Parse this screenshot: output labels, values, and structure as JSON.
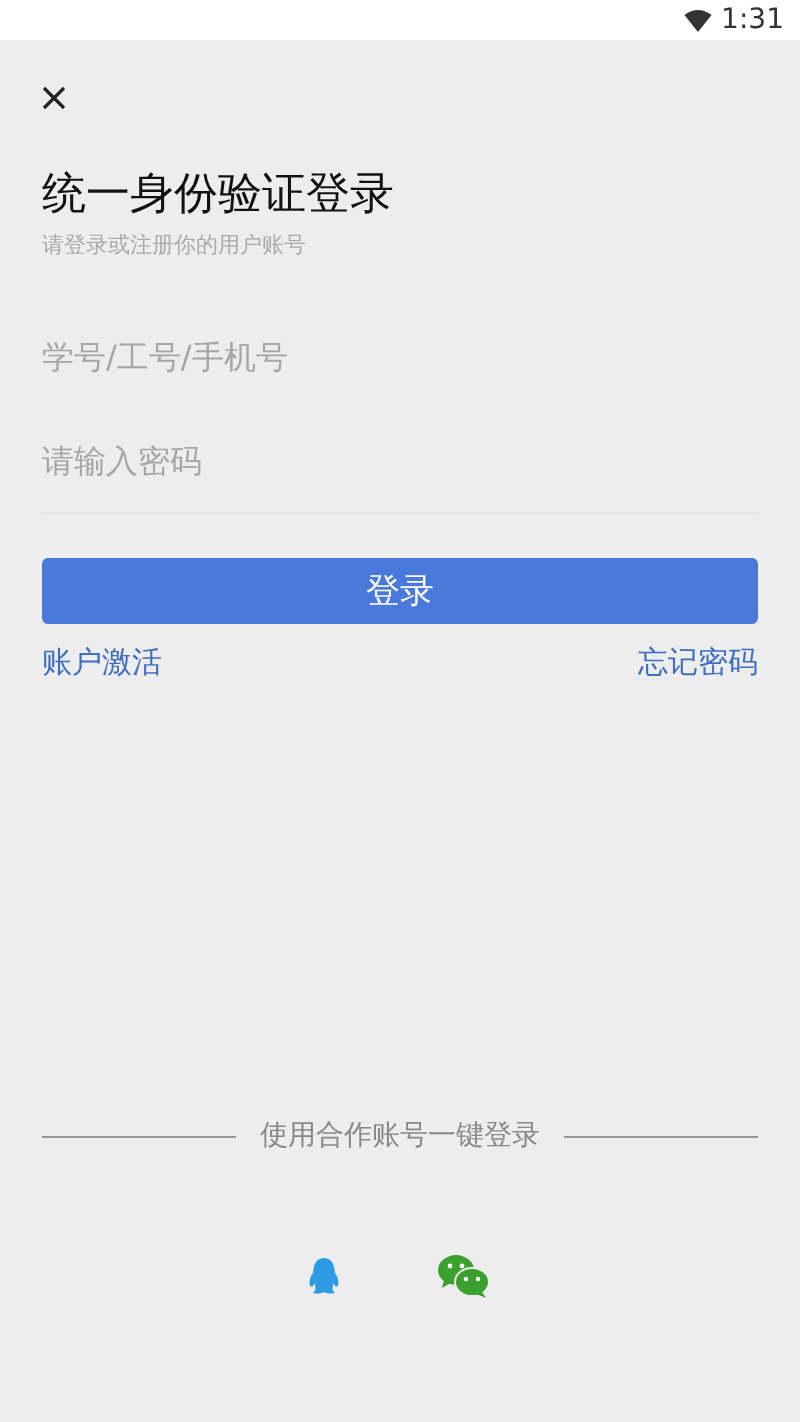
{
  "status_bar": {
    "time": "1:31"
  },
  "title": "统一身份验证登录",
  "subtitle": "请登录或注册你的用户账号",
  "fields": [
    {
      "placeholder": "学号/工号/手机号"
    },
    {
      "placeholder": "请输入密码"
    }
  ],
  "login_button": "登录",
  "links": [
    "账户激活",
    "忘记密码"
  ],
  "partner_login": {
    "label": "使用合作账号一键登录",
    "options": [
      {
        "kind": "penguin"
      },
      {
        "kind": "chat"
      }
    ]
  }
}
